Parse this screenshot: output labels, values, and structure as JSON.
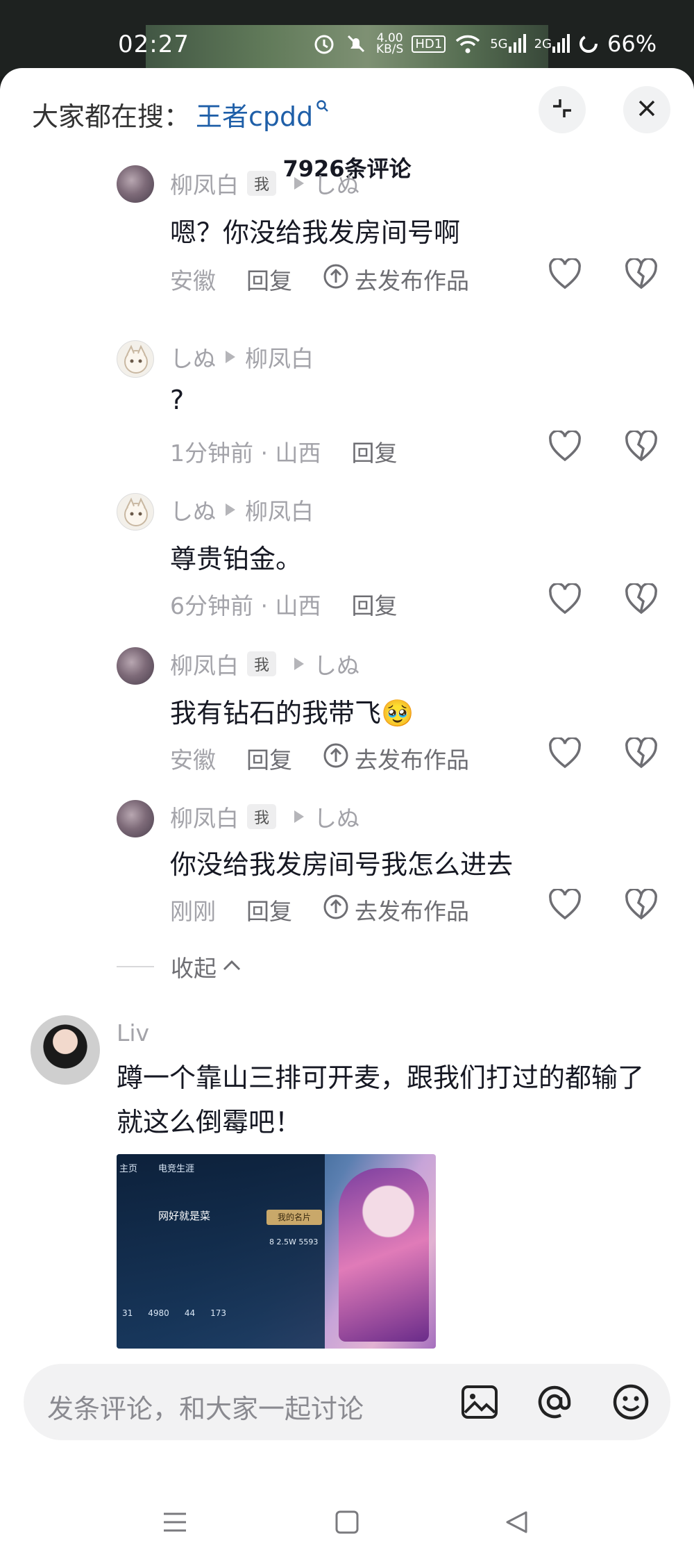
{
  "status_bar": {
    "time": "02:27",
    "speed_value": "4.00",
    "speed_unit": "KB/S",
    "hd_badge": "HD1",
    "network_5g": "5G",
    "network_2g": "2G",
    "battery": "66%"
  },
  "header": {
    "search_prefix": "大家都在搜：",
    "search_term": "王者cpdd",
    "comment_count": "7926条评论"
  },
  "replies": [
    {
      "author": "柳凤白",
      "is_me": true,
      "me_label": "我",
      "target": "しぬ",
      "text": "嗯？你没给我发房间号啊",
      "time_location": "安徽",
      "reply_label": "回复",
      "publish_label": "去发布作品"
    },
    {
      "author": "しぬ",
      "is_me": false,
      "target": "柳凤白",
      "text": "?",
      "time_location": "1分钟前 · 山西",
      "reply_label": "回复"
    },
    {
      "author": "しぬ",
      "is_me": false,
      "target": "柳凤白",
      "text": "尊贵铂金。",
      "time_location": "6分钟前 · 山西",
      "reply_label": "回复"
    },
    {
      "author": "柳凤白",
      "is_me": true,
      "me_label": "我",
      "target": "しぬ",
      "text": "我有钻石的我带飞🥹",
      "time_location": "安徽",
      "reply_label": "回复",
      "publish_label": "去发布作品"
    },
    {
      "author": "柳凤白",
      "is_me": true,
      "me_label": "我",
      "target": "しぬ",
      "text": "你没给我发房间号我怎么进去",
      "time_location": "刚刚",
      "reply_label": "回复",
      "publish_label": "去发布作品"
    }
  ],
  "collapse_label": "收起",
  "comment": {
    "author": "Liv",
    "text": "蹲一个靠山三排可开麦，跟我们打过的都输了就这么倒霉吧！",
    "image": {
      "tab_home": "主页",
      "tab_career": "电竞生涯",
      "player_name": "网好就是菜",
      "card_label": "我的名片",
      "stats": "8   2.5W   5593",
      "bottom_values": [
        "31",
        "4980",
        "44",
        "173"
      ]
    }
  },
  "input_bar": {
    "placeholder": "发条评论，和大家一起讨论"
  },
  "icons": {
    "search": "search-icon",
    "collapse": "collapse-icon",
    "close": "close-icon",
    "like": "heart-icon",
    "dislike": "broken-heart-icon",
    "publish": "upload-circle-icon",
    "image": "image-icon",
    "mention": "at-icon",
    "emoji": "emoji-icon"
  },
  "colors": {
    "accent_link": "#1f5fa8",
    "text_primary": "#161823",
    "text_secondary": "#a3a3a9"
  }
}
